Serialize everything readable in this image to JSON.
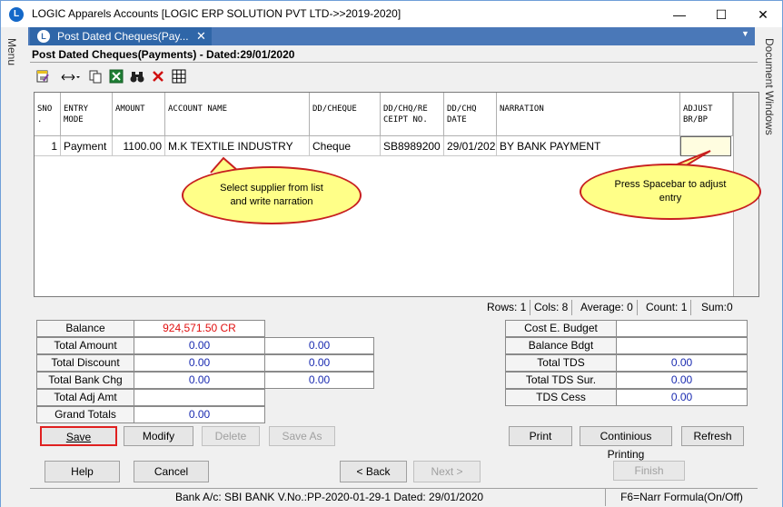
{
  "window": {
    "title": "LOGIC Apparels Accounts  [LOGIC ERP SOLUTION PVT LTD->>2019-2020]",
    "minimize": "—",
    "maximize": "☐",
    "close": "✕"
  },
  "rails": {
    "left_label": "Menu",
    "right_label": "Document Windows"
  },
  "tab": {
    "label": "Post Dated Cheques(Pay...",
    "close": "✕"
  },
  "form": {
    "heading": "Post Dated Cheques(Payments) - Dated:29/01/2020"
  },
  "grid": {
    "headers": [
      "SNO\n.",
      "ENTRY\nMODE",
      "AMOUNT",
      "ACCOUNT NAME",
      "DD/CHEQUE",
      "DD/CHQ/RE\nCEIPT NO.",
      "DD/CHQ\nDATE",
      "NARRATION",
      "ADJUST\nBR/BP"
    ],
    "rows": [
      [
        "1",
        "Payment",
        "1100.00",
        "M.K TEXTILE INDUSTRY",
        "Cheque",
        "SB8989200",
        "29/01/202",
        "BY BANK PAYMENT",
        ""
      ]
    ]
  },
  "callouts": {
    "supplier": "Select supplier from list and write narration",
    "spacebar": "Press Spacebar to adjust entry"
  },
  "status": {
    "rows": "Rows: 1",
    "cols": "Cols: 8",
    "average": "Average: 0",
    "count": "Count: 1",
    "sum": "Sum:0"
  },
  "totals_left": {
    "balance_label": "Balance",
    "balance_value": "924,571.50 CR",
    "total_amount_label": "Total Amount",
    "total_amount_1": "0.00",
    "total_amount_2": "0.00",
    "total_discount_label": "Total Discount",
    "total_discount_1": "0.00",
    "total_discount_2": "0.00",
    "total_bank_chg_label": "Total Bank Chg",
    "total_bank_chg_1": "0.00",
    "total_bank_chg_2": "0.00",
    "total_adj_amt_label": "Total Adj Amt",
    "grand_totals_label": "Grand Totals",
    "grand_totals_value": "0.00"
  },
  "totals_right": {
    "cost_budget_label": "Cost E. Budget",
    "balance_bdgt_label": "Balance Bdgt",
    "total_tds_label": "Total TDS",
    "total_tds_value": "0.00",
    "total_tds_sur_label": "Total TDS Sur.",
    "total_tds_sur_value": "0.00",
    "tds_cess_label": "TDS Cess",
    "tds_cess_value": "0.00"
  },
  "buttons": {
    "save": "Save",
    "modify": "Modify",
    "delete": "Delete",
    "save_as": "Save As",
    "print": "Print",
    "continuous_printing": "Continious Printing",
    "refresh": "Refresh",
    "help": "Help",
    "cancel": "Cancel",
    "back": "< Back",
    "next": "Next >",
    "finish": "Finish"
  },
  "bottom_status": {
    "info": "Bank A/c: SBI BANK V.No.:PP-2020-01-29-1 Dated: 29/01/2020",
    "hint": "F6=Narr Formula(On/Off)"
  },
  "colors": {
    "accent": "#2f66a8",
    "balance": "#e01010",
    "value": "#1a2bb0",
    "callout_fill": "#ffff88",
    "callout_border": "#c82020"
  }
}
